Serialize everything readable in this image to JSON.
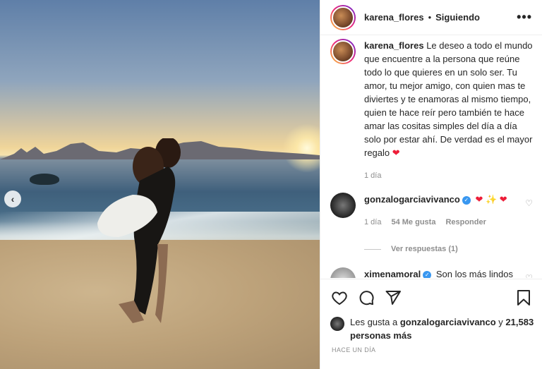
{
  "post": {
    "prev_arrow": "‹"
  },
  "header": {
    "username": "karena_flores",
    "separator": "•",
    "follow_status": "Siguiendo",
    "more": "•••"
  },
  "caption": {
    "username": "karena_flores",
    "text": "Le deseo a todo el mundo que encuentre a la persona que reúne todo lo que quieres en un solo ser. Tu amor, tu mejor amigo, con quien mas te diviertes y te enamoras al mismo tiempo, quien te hace reír pero también te hace amar las cositas simples del día a día solo por estar ahí. De verdad es el mayor regalo",
    "emoji": "❤",
    "time": "1 día"
  },
  "comments": [
    {
      "username": "gonzalogarciavivanco",
      "verified": true,
      "text": "❤ ✨ ❤",
      "time": "1 día",
      "likes": "54 Me gusta",
      "reply": "Responder",
      "view_replies": "Ver respuestas (1)"
    },
    {
      "username": "ximenamoral",
      "verified": true,
      "text": "Son los más lindos del mundo 🌿✨❤"
    }
  ],
  "actions": {
    "icons": [
      "heart-outline-icon",
      "comment-icon",
      "share-icon",
      "bookmark-icon"
    ]
  },
  "likes": {
    "prefix": "Les gusta a",
    "user": "gonzalogarciavivanco",
    "conj": "y",
    "count": "21,583 personas más"
  },
  "date": "HACE UN DÍA",
  "colors": {
    "accent_red": "#ed1d38",
    "verified_blue": "#3897f0",
    "muted": "#8e8e8e"
  }
}
